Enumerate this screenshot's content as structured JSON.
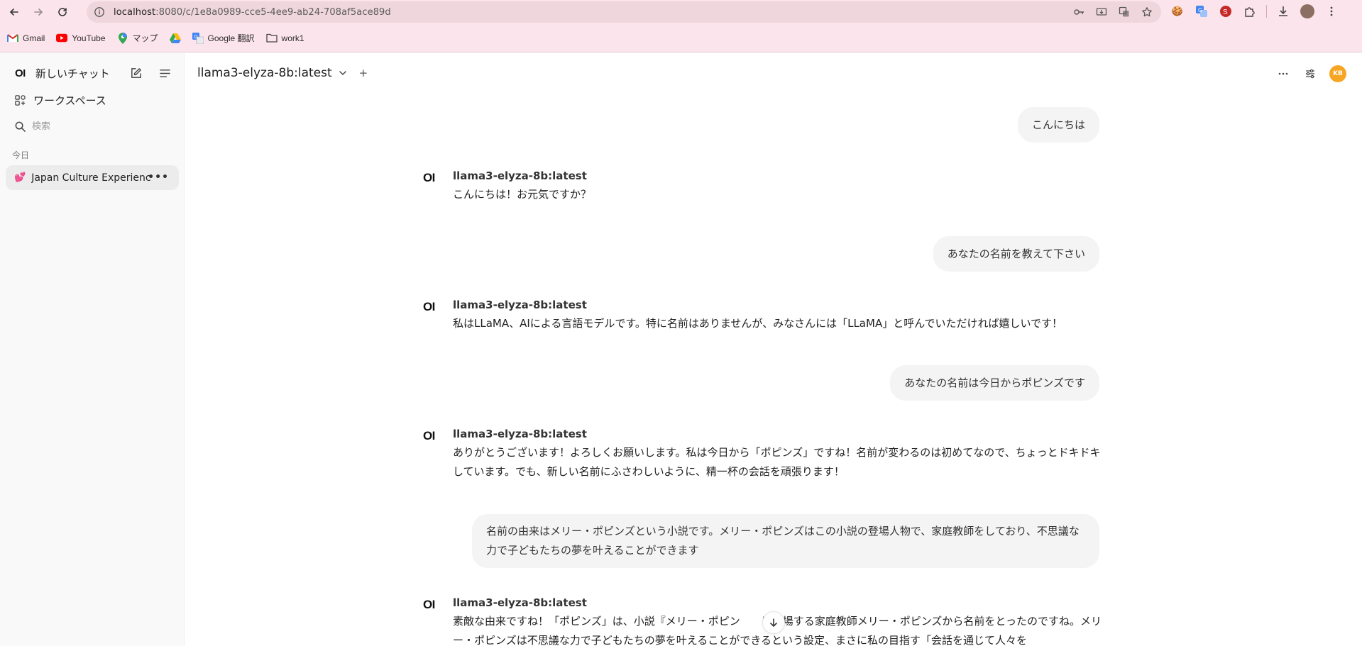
{
  "browser": {
    "url_host": "localhost",
    "url_path": ":8080/c/1e8a0989-cce5-4ee9-ab24-708af5ace89d",
    "bookmarks": [
      {
        "label": "Gmail",
        "icon": "gmail-icon"
      },
      {
        "label": "YouTube",
        "icon": "youtube-icon"
      },
      {
        "label": "マップ",
        "icon": "maps-icon"
      },
      {
        "label": "",
        "icon": "drive-icon"
      },
      {
        "label": "Google 翻訳",
        "icon": "translate-icon"
      },
      {
        "label": "work1",
        "icon": "folder-icon"
      }
    ]
  },
  "sidebar": {
    "logo": "OI",
    "new_chat": "新しいチャット",
    "workspace": "ワークスペース",
    "search_placeholder": "検索",
    "section_today": "今日",
    "chat_items": [
      {
        "emoji": "💕",
        "title": "Japan Culture Experience"
      }
    ]
  },
  "header": {
    "model_name": "llama3-elyza-8b:latest",
    "plus": "+",
    "avatar_initials": "KB",
    "avatar_color": "#f6a623"
  },
  "messages": [
    {
      "role": "user",
      "text": "こんにちは"
    },
    {
      "role": "assistant",
      "model": "llama3-elyza-8b:latest",
      "text": "こんにちは！お元気ですか？"
    },
    {
      "role": "user",
      "text": "あなたの名前を教えて下さい"
    },
    {
      "role": "assistant",
      "model": "llama3-elyza-8b:latest",
      "text": "私はLLaMA、AIによる言語モデルです。特に名前はありませんが、みなさんには「LLaMA」と呼んでいただければ嬉しいです！"
    },
    {
      "role": "user",
      "text": "あなたの名前は今日からポピンズです"
    },
    {
      "role": "assistant",
      "model": "llama3-elyza-8b:latest",
      "text": "ありがとうございます！よろしくお願いします。私は今日から「ポピンズ」ですね！名前が変わるのは初めてなので、ちょっとドキドキしています。でも、新しい名前にふさわしいように、精一杯の会話を頑張ります！"
    },
    {
      "role": "user",
      "text": "名前の由来はメリー・ポピンズという小説です。メリー・ポピンズはこの小説の登場人物で、家庭教師をしており、不思議な力で子どもたちの夢を叶えることができます"
    },
    {
      "role": "assistant",
      "model": "llama3-elyza-8b:latest",
      "text": "素敵な由来ですね！「ポピンズ」は、小説『メリー・ポピン　　に登場する家庭教師メリー・ポピンズから名前をとったのですね。メリー・ポピンズは不思議な力で子どもたちの夢を叶えることができるという設定、まさに私の目指す「会話を通じて人々を"
    }
  ]
}
